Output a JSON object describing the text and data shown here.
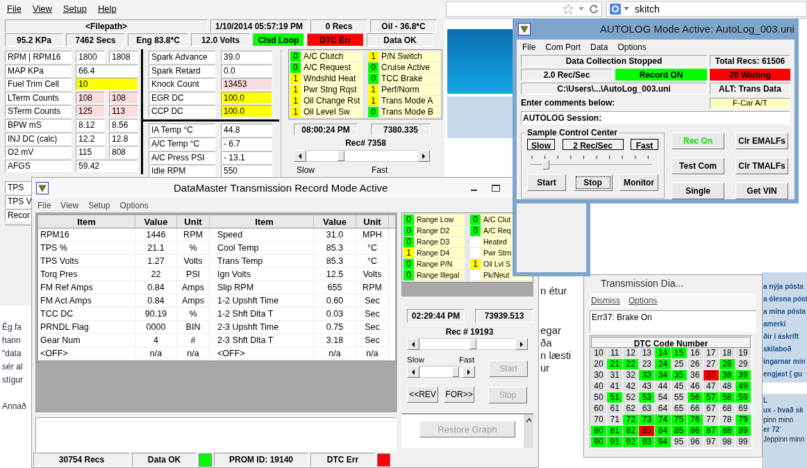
{
  "browser": {
    "search_query": "skitch",
    "side_links": [
      {
        "text": "a nýja pósta",
        "bold": true
      },
      {
        "text": "a ólesna póst",
        "bold": true
      },
      {
        "text": "a mína pósta",
        "bold": true
      },
      {
        "text": "amerki",
        "bold": true
      },
      {
        "text": "ðir í áskrift",
        "bold": true
      },
      {
        "text": "skilaboð",
        "bold": true
      },
      {
        "text": "ingarnar mín",
        "bold": true
      },
      {
        "text": "engjast [ gu",
        "bold": true
      }
    ],
    "lower_links": [
      {
        "text": "L",
        "bold": true
      },
      {
        "text": "ux - hvað sk",
        "bold": true
      },
      {
        "text": "pinn minn",
        "bold": false
      },
      {
        "text": "er 72`",
        "bold": true
      },
      {
        "text": "Jeppinn minn",
        "bold": false
      }
    ],
    "behind_text": [
      "n étur",
      "egar",
      "ða",
      "n læsti",
      "ur"
    ],
    "left_text": [
      "Ég fa",
      "hann",
      "\"data",
      "sér al",
      "stígur",
      "Annað"
    ]
  },
  "main_window": {
    "menu": [
      "File",
      "View",
      "Setup",
      "Help"
    ],
    "header_row": [
      "<Filepath>",
      "1/10/2014  05:57:19 PM",
      "0 Recs",
      "Oil - 36.8*C"
    ],
    "status_row": [
      {
        "text": "95.2 KPa",
        "color": "#f0f0f0"
      },
      {
        "text": "7462 Secs",
        "color": "#f0f0f0"
      },
      {
        "text": "Eng  83.8*C",
        "color": "#f0f0f0"
      },
      {
        "text": "12.0 Volts",
        "color": "#f0f0f0"
      },
      {
        "text": "Clsd Loop",
        "color": "#00ff00"
      },
      {
        "text": "DTC Err",
        "color": "#ff0000"
      },
      {
        "text": "Data OK",
        "color": "#f0f0f0"
      }
    ],
    "engine_params": [
      {
        "label": "RPM   |   RPM16",
        "values": [
          {
            "text": "1800",
            "color": "#ffffff"
          },
          {
            "text": "1808",
            "color": "#ffffff"
          }
        ]
      },
      {
        "label": "MAP KPa",
        "values": [
          {
            "text": "66.4",
            "color": "#ffffff"
          }
        ]
      },
      {
        "label": "Fuel Trim Cell",
        "values": [
          {
            "text": "10",
            "color": "#ffff00"
          }
        ]
      },
      {
        "label": "LTerm Counts",
        "values": [
          {
            "text": "108",
            "color": "#fadcdc"
          },
          {
            "text": "108",
            "color": "#fadcdc"
          }
        ]
      },
      {
        "label": "STerm Counts",
        "values": [
          {
            "text": "125",
            "color": "#fadcdc"
          },
          {
            "text": "113",
            "color": "#fadcdc"
          }
        ]
      },
      {
        "label": "BPW  mS",
        "values": [
          {
            "text": "8.12",
            "color": "#ffffff"
          },
          {
            "text": "8.56",
            "color": "#ffffff"
          }
        ]
      },
      {
        "label": "INJ DC (calc)",
        "values": [
          {
            "text": "12.2",
            "color": "#ffffff"
          },
          {
            "text": "12.8",
            "color": "#ffffff"
          }
        ]
      },
      {
        "label": "O2 mV",
        "values": [
          {
            "text": "115",
            "color": "#ffffff"
          },
          {
            "text": "808",
            "color": "#ffffff"
          }
        ]
      },
      {
        "label": "AFGS",
        "values": [
          {
            "text": "59.42",
            "color": "#ffffff"
          }
        ]
      },
      {
        "label": "TPS"
      },
      {
        "label": "TPS V"
      },
      {
        "label": "Recor"
      }
    ],
    "spark_params": [
      {
        "label": "Spark Advance",
        "value": "39.0",
        "color": "#ffffff"
      },
      {
        "label": "Spark Retard",
        "value": "0.0",
        "color": "#ffffff"
      },
      {
        "label": "Knock Count",
        "value": "13453",
        "color": "#fadcdc"
      },
      {
        "label": "EGR DC",
        "value": "100.0",
        "color": "#ffff00"
      },
      {
        "label": "CCP DC",
        "value": "100.0",
        "color": "#ffff00"
      }
    ],
    "temp_params": [
      {
        "label": "IA Temp °C",
        "value": "44.8",
        "color": "#ffffff"
      },
      {
        "label": "A/C Temp °C",
        "value": "- 6.7",
        "color": "#ffffff"
      },
      {
        "label": "A/C Press PSI",
        "value": "- 13.1",
        "color": "#ffffff"
      },
      {
        "label": "Idle RPM",
        "value": "550",
        "color": "#ffffff"
      }
    ],
    "flags": [
      {
        "bit": "0",
        "name": "A/C Clutch",
        "color": "#00ff00"
      },
      {
        "bit": "1",
        "name": "P/N Switch",
        "color": "#ffff00"
      },
      {
        "bit": "0",
        "name": "A/C Request",
        "color": "#00ff00"
      },
      {
        "bit": "0",
        "name": "Cruise Active",
        "color": "#00ff00"
      },
      {
        "bit": "1",
        "name": "Wndshld Heat",
        "color": "#ffff00"
      },
      {
        "bit": "0",
        "name": "TCC Brake",
        "color": "#00ff00"
      },
      {
        "bit": "1",
        "name": "Pwr Stng Rqst",
        "color": "#ffff00"
      },
      {
        "bit": "1",
        "name": "Perf/Norm",
        "color": "#ffff00"
      },
      {
        "bit": "1",
        "name": "Oil Change Rst",
        "color": "#ffff00"
      },
      {
        "bit": "1",
        "name": "Trans Mode A",
        "color": "#ffff00"
      },
      {
        "bit": "1",
        "name": "Oil Level Sw",
        "color": "#ffff00"
      },
      {
        "bit": "0",
        "name": "Trans Mode B",
        "color": "#00ff00"
      }
    ],
    "playback": {
      "time": "08:00:24 PM",
      "elapsed": "7380.335",
      "record": "Rec# 7358",
      "level": 0.3,
      "slow": "Slow",
      "fast": "Fast"
    }
  },
  "transmission": {
    "title": "DataMaster Transmission Record Mode Active",
    "menu": [
      "File",
      "View",
      "Setup",
      "Options"
    ],
    "columns": [
      "Item",
      "Value",
      "Unit",
      "Item",
      "Value",
      "Unit"
    ],
    "rows": [
      [
        "RPM16",
        "1446",
        "RPM",
        "Speed",
        "31.0",
        "MPH"
      ],
      [
        "TPS %",
        "21.1",
        "%",
        "Cool Temp",
        "85.3",
        "°C"
      ],
      [
        "TPS Volts",
        "1.27",
        "Volts",
        "Trans Temp",
        "85.3",
        "°C"
      ],
      [
        "Torq Pres",
        "22",
        "PSI",
        "Ign Volts",
        "12.5",
        "Volts"
      ],
      [
        "FM Ref Amps",
        "0.84",
        "Amps",
        "Slip RPM",
        "655",
        "RPM"
      ],
      [
        "FM Act Amps",
        "0.84",
        "Amps",
        "1-2 Upshft Time",
        "0.60",
        "Sec"
      ],
      [
        "TCC DC",
        "90.19",
        "%",
        "1-2 Shft Dlta T",
        "0.03",
        "Sec"
      ],
      [
        "PRNDL Flag",
        "0000",
        "BIN",
        "2-3 Upshft Time",
        "0.75",
        "Sec"
      ],
      [
        "Gear Num",
        "4",
        "#",
        "2-3 Shft Dlta T",
        "3.18",
        "Sec"
      ],
      [
        "<OFF>",
        "n/a",
        "n/a",
        "<OFF>",
        "n/a",
        "n/a"
      ]
    ],
    "flags": [
      {
        "bit": "0",
        "name": "Range Low",
        "color": "#00ff00"
      },
      {
        "bit": "0",
        "name": "A/C Clut",
        "color": "#00ff00"
      },
      {
        "bit": "0",
        "name": "Range D2",
        "color": "#00ff00"
      },
      {
        "bit": "0",
        "name": "A/C Req",
        "color": "#00ff00"
      },
      {
        "bit": "0",
        "name": "Range D3",
        "color": "#00ff00"
      },
      {
        "name": "Heated",
        "color": "#ffffff"
      },
      {
        "bit": "1",
        "name": "Range D4",
        "color": "#ffff00"
      },
      {
        "name": "Pwr Strn",
        "color": "#ffffff"
      },
      {
        "bit": "0",
        "name": "Range P/N",
        "color": "#00ff00"
      },
      {
        "bit": "1",
        "name": "Oil Lvl S",
        "color": "#ffff00"
      },
      {
        "bit": "0",
        "name": "Range Illegal",
        "color": "#00ff00"
      },
      {
        "name": "Pk/Neut",
        "color": "#ffffff"
      }
    ],
    "time": "02:29:44 PM",
    "elapsed": "73939.513",
    "record": "Rec # 19193",
    "level": 0.56,
    "speed": {
      "slow": "Slow",
      "fast": "Fast",
      "level": 0.9
    },
    "nav_buttons": [
      {
        "label": "Start",
        "disabled": true
      },
      {
        "label": "<<REV",
        "disabled": false
      },
      {
        "label": "FOR>>",
        "disabled": false
      },
      {
        "label": "Stop",
        "disabled": true
      }
    ],
    "restore_button": {
      "label": "Restore Graph",
      "disabled": true
    },
    "status_bar": [
      {
        "text": "30754 Recs"
      },
      {
        "text": "Data OK",
        "color": "#00ff00"
      },
      {
        "text": "PROM ID:  19140"
      },
      {
        "text": "DTC Err",
        "color": "#ff0000"
      }
    ]
  },
  "autolog": {
    "title": "AUTOLOG Mode Active: AutoLog_003.uni",
    "menu": [
      "File",
      "Com Port",
      "Data",
      "Options"
    ],
    "status": "Data Collection Stopped",
    "total": "Total Recs:  61506",
    "rate": "2.0 Rec/Sec",
    "record_state": {
      "text": "Record ON",
      "color": "#00ff00"
    },
    "waiting": {
      "text": "20 Waiting",
      "color": "#ff0000"
    },
    "path": "C:\\Users\\...\\AutoLog_003.uni",
    "alt": "ALT: Trans Data",
    "comments_label": "Enter comments below:",
    "vehicle": "F-Car A/T",
    "comment": "AUTOLOG Session:",
    "sample": {
      "title": "Sample Control Center",
      "slow": "Slow",
      "rate": "2 Rec/Sec",
      "fast": "Fast",
      "level": 0.11,
      "buttons": [
        {
          "label": "Start",
          "focused": false
        },
        {
          "label": "Stop",
          "focused": true
        },
        {
          "label": "Monitor",
          "focused": false
        }
      ]
    },
    "buttons": [
      {
        "label": "Rec On",
        "active": true
      },
      {
        "label": "Clr EMALFs",
        "active": false
      },
      {
        "label": "Test Com",
        "active": false
      },
      {
        "label": "Clr TMALFs",
        "active": false
      },
      {
        "label": "Single",
        "active": false
      },
      {
        "label": "Get VIN",
        "active": false
      }
    ]
  },
  "dtc_window": {
    "title": "Transmission Dia...",
    "menu": [
      "Dismiss",
      "Options"
    ],
    "message": "Err37:  Brake On",
    "grid_title": "DTC Code Number",
    "codes": [
      {
        "code": "10",
        "color": "#e0e0e0"
      },
      {
        "code": "11",
        "color": "#e0e0e0"
      },
      {
        "code": "12",
        "color": "#e0e0e0"
      },
      {
        "code": "13",
        "color": "#e0e0e0"
      },
      {
        "code": "14",
        "color": "#00ff00"
      },
      {
        "code": "15",
        "color": "#00ff00"
      },
      {
        "code": "16",
        "color": "#e0e0e0"
      },
      {
        "code": "17",
        "color": "#e0e0e0"
      },
      {
        "code": "18",
        "color": "#e0e0e0"
      },
      {
        "code": "19",
        "color": "#e0e0e0"
      },
      {
        "code": "20",
        "color": "#e0e0e0"
      },
      {
        "code": "21",
        "color": "#00ff00"
      },
      {
        "code": "22",
        "color": "#00ff00"
      },
      {
        "code": "23",
        "color": "#e0e0e0"
      },
      {
        "code": "24",
        "color": "#00ff00"
      },
      {
        "code": "25",
        "color": "#e0e0e0"
      },
      {
        "code": "26",
        "color": "#e0e0e0"
      },
      {
        "code": "27",
        "color": "#e0e0e0"
      },
      {
        "code": "28",
        "color": "#00ff00"
      },
      {
        "code": "29",
        "color": "#e0e0e0"
      },
      {
        "code": "30",
        "color": "#e0e0e0"
      },
      {
        "code": "31",
        "color": "#e0e0e0"
      },
      {
        "code": "32",
        "color": "#e0e0e0"
      },
      {
        "code": "33",
        "color": "#00ff00"
      },
      {
        "code": "34",
        "color": "#00ff00"
      },
      {
        "code": "35",
        "color": "#00ff00"
      },
      {
        "code": "36",
        "color": "#e0e0e0"
      },
      {
        "code": "37",
        "color": "#ff0000"
      },
      {
        "code": "38",
        "color": "#00ff00"
      },
      {
        "code": "39",
        "color": "#00ff00"
      },
      {
        "code": "40",
        "color": "#e0e0e0"
      },
      {
        "code": "41",
        "color": "#e0e0e0"
      },
      {
        "code": "42",
        "color": "#e0e0e0"
      },
      {
        "code": "43",
        "color": "#e0e0e0"
      },
      {
        "code": "44",
        "color": "#e0e0e0"
      },
      {
        "code": "45",
        "color": "#e0e0e0"
      },
      {
        "code": "46",
        "color": "#e0e0e0"
      },
      {
        "code": "47",
        "color": "#e0e0e0"
      },
      {
        "code": "48",
        "color": "#e0e0e0"
      },
      {
        "code": "49",
        "color": "#00ff00"
      },
      {
        "code": "50",
        "color": "#e0e0e0"
      },
      {
        "code": "51",
        "color": "#00ff00"
      },
      {
        "code": "52",
        "color": "#e0e0e0"
      },
      {
        "code": "53",
        "color": "#00ff00"
      },
      {
        "code": "54",
        "color": "#e0e0e0"
      },
      {
        "code": "55",
        "color": "#e0e0e0"
      },
      {
        "code": "56",
        "color": "#00ff00"
      },
      {
        "code": "57",
        "color": "#00ff00"
      },
      {
        "code": "58",
        "color": "#00ff00"
      },
      {
        "code": "59",
        "color": "#00ff00"
      },
      {
        "code": "60",
        "color": "#e0e0e0"
      },
      {
        "code": "61",
        "color": "#e0e0e0"
      },
      {
        "code": "62",
        "color": "#e0e0e0"
      },
      {
        "code": "63",
        "color": "#e0e0e0"
      },
      {
        "code": "64",
        "color": "#e0e0e0"
      },
      {
        "code": "65",
        "color": "#e0e0e0"
      },
      {
        "code": "66",
        "color": "#e0e0e0"
      },
      {
        "code": "67",
        "color": "#e0e0e0"
      },
      {
        "code": "68",
        "color": "#e0e0e0"
      },
      {
        "code": "69",
        "color": "#e0e0e0"
      },
      {
        "code": "70",
        "color": "#e0e0e0"
      },
      {
        "code": "71",
        "color": "#e0e0e0"
      },
      {
        "code": "72",
        "color": "#00ff00"
      },
      {
        "code": "73",
        "color": "#00ff00"
      },
      {
        "code": "74",
        "color": "#00ff00"
      },
      {
        "code": "75",
        "color": "#00ff00"
      },
      {
        "code": "76",
        "color": "#00ff00"
      },
      {
        "code": "77",
        "color": "#e0e0e0"
      },
      {
        "code": "78",
        "color": "#e0e0e0"
      },
      {
        "code": "79",
        "color": "#00ff00"
      },
      {
        "code": "80",
        "color": "#00ff00"
      },
      {
        "code": "81",
        "color": "#00ff00"
      },
      {
        "code": "82",
        "color": "#00ff00"
      },
      {
        "code": "83",
        "color": "#ff0000"
      },
      {
        "code": "84",
        "color": "#00ff00"
      },
      {
        "code": "85",
        "color": "#00ff00"
      },
      {
        "code": "86",
        "color": "#00ff00"
      },
      {
        "code": "87",
        "color": "#00ff00"
      },
      {
        "code": "88",
        "color": "#00ff00"
      },
      {
        "code": "89",
        "color": "#00ff00"
      },
      {
        "code": "90",
        "color": "#00ff00"
      },
      {
        "code": "91",
        "color": "#00ff00"
      },
      {
        "code": "92",
        "color": "#00ff00"
      },
      {
        "code": "93",
        "color": "#00ff00"
      },
      {
        "code": "94",
        "color": "#00ff00"
      },
      {
        "code": "95",
        "color": "#e0e0e0"
      },
      {
        "code": "96",
        "color": "#e0e0e0"
      },
      {
        "code": "97",
        "color": "#e0e0e0"
      },
      {
        "code": "98",
        "color": "#e0e0e0"
      },
      {
        "code": "99",
        "color": "#e0e0e0"
      }
    ]
  }
}
